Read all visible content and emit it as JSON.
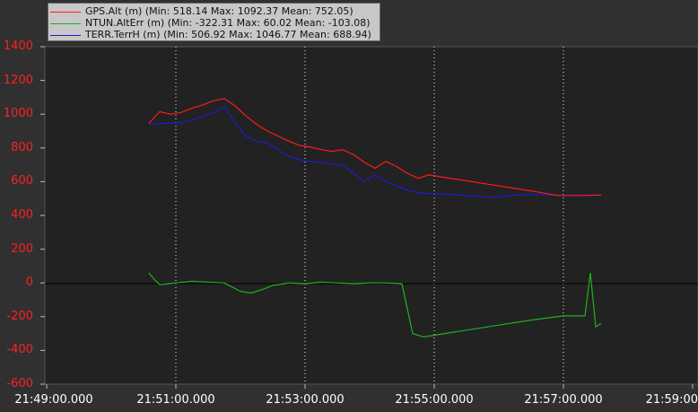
{
  "chart_data": {
    "type": "line",
    "x_ticks": [
      "21:49:00.000",
      "21:51:00.000",
      "21:53:00.000",
      "21:55:00.000",
      "21:57:00.000",
      "21:59:00"
    ],
    "y_ticks": [
      "1400",
      "1200",
      "1000",
      "800",
      "600",
      "400",
      "200",
      "0",
      "-200",
      "-400",
      "-600"
    ],
    "ylim": [
      -600,
      1400
    ],
    "xlim": [
      "21:49:00",
      "21:59:00"
    ],
    "grid": "vertical dotted lines at labelled x ticks",
    "legend": "top-left",
    "colors": {
      "background": "#303030",
      "plot_area": "#222222",
      "y_tick_labels": "#ff2020",
      "x_tick_labels": "#ffffff"
    },
    "series": [
      {
        "name": "GPS.Alt (m) (Min: 518.14 Max: 1092.37 Mean: 752.05)",
        "color": "#ff1a1a",
        "x": [
          "21:50:35",
          "21:50:45",
          "21:50:55",
          "21:51:05",
          "21:51:15",
          "21:51:25",
          "21:51:35",
          "21:51:45",
          "21:51:55",
          "21:52:05",
          "21:52:15",
          "21:52:25",
          "21:52:35",
          "21:52:45",
          "21:52:55",
          "21:53:05",
          "21:53:15",
          "21:53:25",
          "21:53:35",
          "21:53:45",
          "21:53:55",
          "21:54:05",
          "21:54:15",
          "21:54:25",
          "21:54:35",
          "21:54:45",
          "21:54:55",
          "21:55:15",
          "21:55:35",
          "21:55:55",
          "21:56:15",
          "21:56:35",
          "21:56:55",
          "21:57:15",
          "21:57:35"
        ],
        "y": [
          945,
          1015,
          1000,
          1010,
          1035,
          1055,
          1080,
          1092,
          1050,
          990,
          940,
          900,
          870,
          840,
          815,
          805,
          790,
          780,
          790,
          760,
          715,
          680,
          720,
          690,
          650,
          620,
          640,
          620,
          600,
          580,
          560,
          540,
          518,
          518,
          520
        ]
      },
      {
        "name": "NTUN.AltErr (m) (Min: -322.31 Max: 60.02 Mean: -103.08)",
        "color": "#20b020",
        "x": [
          "21:50:35",
          "21:50:40",
          "21:50:45",
          "21:51:00",
          "21:51:15",
          "21:51:30",
          "21:51:45",
          "21:52:00",
          "21:52:10",
          "21:52:20",
          "21:52:30",
          "21:52:45",
          "21:53:00",
          "21:53:15",
          "21:53:30",
          "21:53:45",
          "21:54:00",
          "21:54:15",
          "21:54:30",
          "21:54:40",
          "21:54:50",
          "21:55:00",
          "21:55:30",
          "21:56:00",
          "21:56:30",
          "21:57:00",
          "21:57:15",
          "21:57:20",
          "21:57:25",
          "21:57:30",
          "21:57:35"
        ],
        "y": [
          60,
          20,
          -10,
          0,
          10,
          5,
          0,
          -50,
          -60,
          -40,
          -15,
          0,
          -5,
          5,
          0,
          -5,
          0,
          0,
          -5,
          -300,
          -320,
          -310,
          -280,
          -250,
          -220,
          -195,
          -195,
          -195,
          60,
          -260,
          -240
        ]
      },
      {
        "name": "TERR.TerrH (m) (Min: 506.92 Max: 1046.77 Mean: 688.94)",
        "color": "#1c1ccc",
        "x": [
          "21:50:35",
          "21:50:50",
          "21:51:05",
          "21:51:20",
          "21:51:35",
          "21:51:45",
          "21:51:55",
          "21:52:05",
          "21:52:15",
          "21:52:25",
          "21:52:35",
          "21:52:45",
          "21:52:55",
          "21:53:05",
          "21:53:15",
          "21:53:25",
          "21:53:35",
          "21:53:45",
          "21:53:55",
          "21:54:05",
          "21:54:15",
          "21:54:25",
          "21:54:35",
          "21:54:45",
          "21:54:55",
          "21:55:15",
          "21:55:35",
          "21:55:55",
          "21:56:15",
          "21:56:35",
          "21:56:55",
          "21:57:15",
          "21:57:35"
        ],
        "y": [
          940,
          945,
          950,
          975,
          1010,
          1045,
          950,
          870,
          840,
          830,
          790,
          750,
          730,
          720,
          715,
          705,
          700,
          650,
          600,
          640,
          600,
          575,
          550,
          535,
          530,
          525,
          515,
          507,
          520,
          525,
          520,
          520,
          520
        ]
      }
    ]
  }
}
